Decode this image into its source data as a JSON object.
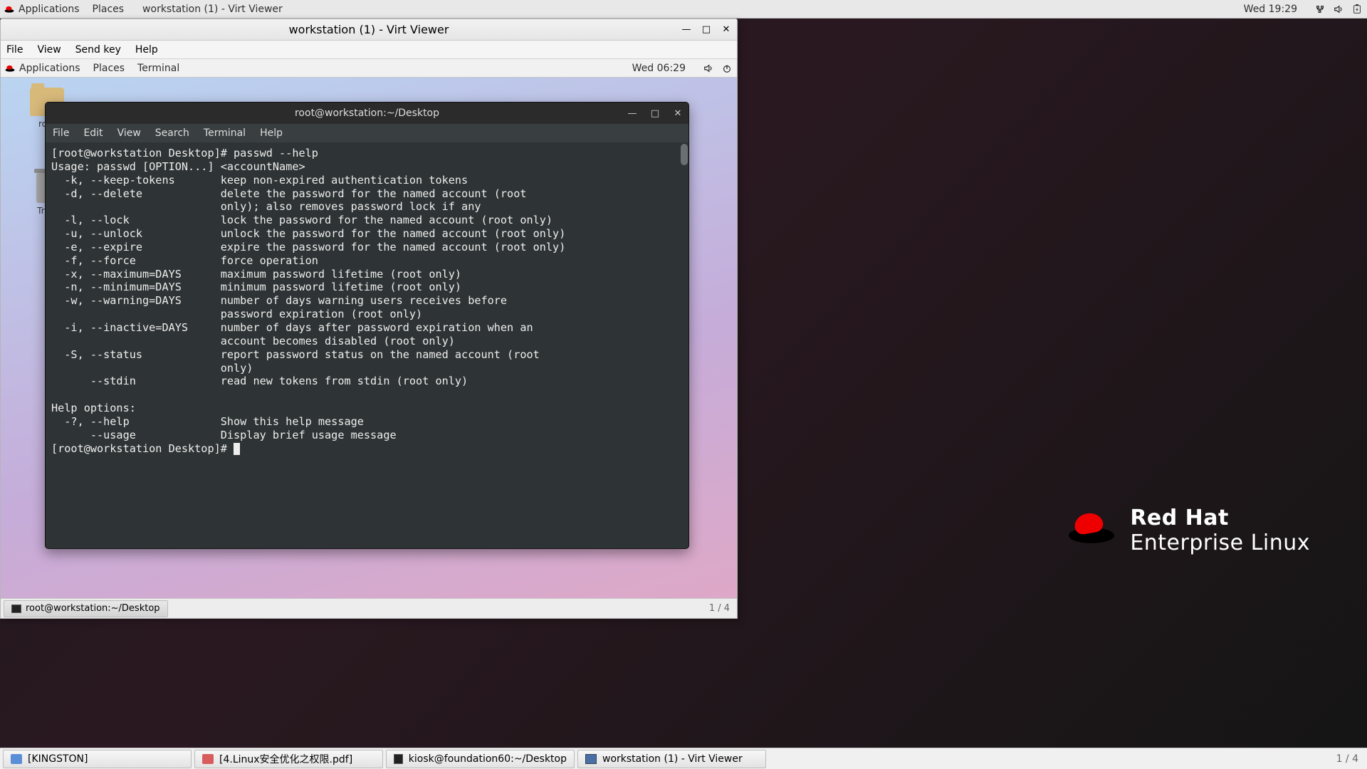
{
  "host": {
    "topbar": {
      "applications": "Applications",
      "places": "Places",
      "active_app": "workstation (1) - Virt Viewer",
      "clock": "Wed 19:29"
    },
    "taskbar": {
      "items": [
        {
          "label": "[KINGSTON]",
          "icon": "disk"
        },
        {
          "label": "[4.Linux安全优化之权限.pdf]",
          "icon": "pdf"
        },
        {
          "label": "kiosk@foundation60:~/Desktop",
          "icon": "term"
        },
        {
          "label": "workstation (1) - Virt Viewer",
          "icon": "display"
        }
      ],
      "workspace": "1 / 4"
    }
  },
  "virt": {
    "title": "workstation (1) - Virt Viewer",
    "menubar": [
      "File",
      "View",
      "Send key",
      "Help"
    ]
  },
  "guest": {
    "topbar": {
      "applications": "Applications",
      "places": "Places",
      "active_app": "Terminal",
      "clock": "Wed 06:29"
    },
    "desktop_icons": {
      "home": "root",
      "trash": "Trash"
    },
    "taskbar": {
      "task": "root@workstation:~/Desktop",
      "workspace": "1 / 4"
    }
  },
  "terminal": {
    "title": "root@workstation:~/Desktop",
    "menubar": [
      "File",
      "Edit",
      "View",
      "Search",
      "Terminal",
      "Help"
    ],
    "content": "[root@workstation Desktop]# passwd --help\nUsage: passwd [OPTION...] <accountName>\n  -k, --keep-tokens       keep non-expired authentication tokens\n  -d, --delete            delete the password for the named account (root\n                          only); also removes password lock if any\n  -l, --lock              lock the password for the named account (root only)\n  -u, --unlock            unlock the password for the named account (root only)\n  -e, --expire            expire the password for the named account (root only)\n  -f, --force             force operation\n  -x, --maximum=DAYS      maximum password lifetime (root only)\n  -n, --minimum=DAYS      minimum password lifetime (root only)\n  -w, --warning=DAYS      number of days warning users receives before\n                          password expiration (root only)\n  -i, --inactive=DAYS     number of days after password expiration when an\n                          account becomes disabled (root only)\n  -S, --status            report password status on the named account (root\n                          only)\n      --stdin             read new tokens from stdin (root only)\n\nHelp options:\n  -?, --help              Show this help message\n      --usage             Display brief usage message\n[root@workstation Desktop]# "
  },
  "brand": {
    "line1": "Red Hat",
    "line2": "Enterprise Linux"
  }
}
